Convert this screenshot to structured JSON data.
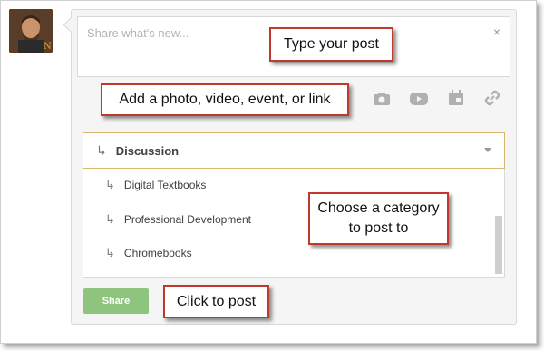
{
  "post": {
    "placeholder": "Share what's new...",
    "close_glyph": "×"
  },
  "toolbar_icons": [
    {
      "name": "camera-icon"
    },
    {
      "name": "youtube-icon"
    },
    {
      "name": "calendar-icon"
    },
    {
      "name": "link-icon"
    }
  ],
  "category": {
    "selected": "Discussion",
    "options": [
      "Digital Textbooks",
      "Professional Development",
      "Chromebooks"
    ]
  },
  "share_label": "Share",
  "callouts": {
    "type_post": "Type your post",
    "add_media": "Add a photo, video, event, or link",
    "choose_category_line1": "Choose a category",
    "choose_category_line2": "to post to",
    "click_post": "Click to post"
  },
  "colors": {
    "callout_border": "#c0392b",
    "share_button": "#8fc47e",
    "select_border": "#d8b66b"
  }
}
